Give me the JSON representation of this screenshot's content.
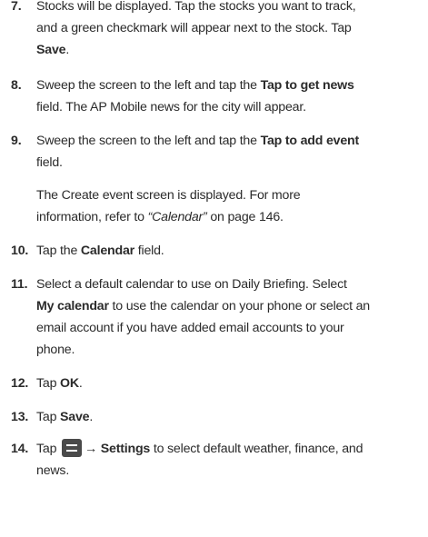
{
  "steps": [
    {
      "number": "7.",
      "lines": [
        {
          "t1": "Stocks will be displayed. Tap the stocks you want to track,"
        },
        {
          "t1": "and a green checkmark will appear next to the stock. Tap"
        },
        {
          "b1": "Save",
          "t2": "."
        }
      ]
    },
    {
      "number": "8.",
      "lines": [
        {
          "t1": "Sweep the screen to the left and tap the ",
          "b1": "Tap to get news"
        },
        {
          "t1": "field. The AP Mobile news for the city will appear."
        }
      ]
    },
    {
      "number": "9.",
      "lines": [
        {
          "t1": "Sweep the screen to the left and tap the ",
          "b1": "Tap to add event"
        },
        {
          "t1": "field."
        }
      ],
      "note_lines": [
        {
          "t1": "The Create event screen is displayed. For more"
        },
        {
          "t1": "information, refer to ",
          "i1": "“Calendar”",
          "t2": " on page 146."
        }
      ]
    },
    {
      "number": "10.",
      "lines": [
        {
          "t1": "Tap the ",
          "b1": "Calendar",
          "t2": " field."
        }
      ]
    },
    {
      "number": "11.",
      "lines": [
        {
          "t1": "Select a default calendar to use on Daily Briefing. Select"
        },
        {
          "b1": "My calendar",
          "t2": " to use the calendar on your phone or select an"
        },
        {
          "t1": "email account if you have added email accounts to your"
        },
        {
          "t1": "phone."
        }
      ]
    },
    {
      "number": "12.",
      "lines": [
        {
          "t1": "Tap ",
          "b1": "OK",
          "t2": "."
        }
      ]
    },
    {
      "number": "13.",
      "lines": [
        {
          "t1": "Tap ",
          "b1": "Save",
          "t2": "."
        }
      ]
    },
    {
      "number": "14.",
      "lines": [
        {
          "t1": "Tap ",
          "icon": "menu-icon",
          "b1": "→ Settings",
          "t2": " to select default weather, finance, and"
        },
        {
          "t1": "news."
        }
      ]
    }
  ]
}
